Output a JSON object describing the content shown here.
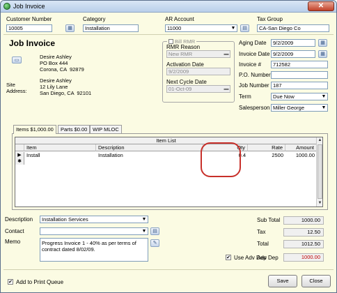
{
  "window": {
    "title": "Job Invoice",
    "close_glyph": "✕"
  },
  "header": {
    "customer_number_label": "Customer Number",
    "customer_number": "10005",
    "category_label": "Category",
    "category": "Installation",
    "ar_account_label": "AR Account",
    "ar_account": "11000",
    "tax_group_label": "Tax Group",
    "tax_group": "CA-San Diego Co"
  },
  "heading": "Job Invoice",
  "address": {
    "bill_to": "Desire Ashley\nPO Box 444\nCorona, CA  92879",
    "site_label": "Site\nAddress:",
    "site": "Desire Ashley\n12 Lily Lane\nSan Diego, CA  92101"
  },
  "rmr": {
    "legend": "Bill RMR",
    "reason_label": "RMR Reason",
    "reason": "New RMR",
    "activation_label": "Activation Date",
    "activation": "9/2/2009",
    "next_cycle_label": "Next Cycle Date",
    "next_cycle": "01-Oct-09"
  },
  "details": {
    "aging_date_label": "Aging Date",
    "aging_date": "9/2/2009",
    "invoice_date_label": "Invoice Date",
    "invoice_date": "9/2/2009",
    "invoice_no_label": "Invoice #",
    "invoice_no": "712582",
    "po_label": "P.O. Number",
    "po": "",
    "job_number_label": "Job Number",
    "job_number": "187",
    "term_label": "Term",
    "term": "Due Now",
    "salesperson_label": "Salesperson",
    "salesperson": "Miller George"
  },
  "tabs": [
    {
      "label": "Items $1,000.00"
    },
    {
      "label": "Parts $0.00"
    },
    {
      "label": "WIP MLOC"
    }
  ],
  "grid": {
    "title": "Item List",
    "columns": [
      "Item",
      "Description",
      "Qty",
      "Rate",
      "Amount"
    ],
    "rows": [
      {
        "item": "Install",
        "description": "Installation",
        "qty": "0.4",
        "rate": "2500",
        "amount": "1000.00"
      }
    ],
    "new_row_marker": "✱",
    "current_row_marker": "▶"
  },
  "footer": {
    "description_label": "Description",
    "description": "Installation Services",
    "contact_label": "Contact",
    "contact": "",
    "memo_label": "Memo",
    "memo": "Progress Invoice 1 - 40% as per terms of contract dated 8/02/09.",
    "use_adv_dep_label": "Use Adv Dep",
    "subtotal_label": "Sub Total",
    "subtotal": "1000.00",
    "tax_label": "Tax",
    "tax": "12.50",
    "total_label": "Total",
    "total": "1012.50",
    "adv_dep_label": "Adv Dep",
    "adv_dep": "1000.00",
    "add_to_print_queue_label": "Add to Print Queue",
    "save_label": "Save",
    "close_label": "Close"
  },
  "colors": {
    "background": "#fbfbe3",
    "highlight": "#c8302a",
    "adv_dep_text": "#c00000"
  }
}
